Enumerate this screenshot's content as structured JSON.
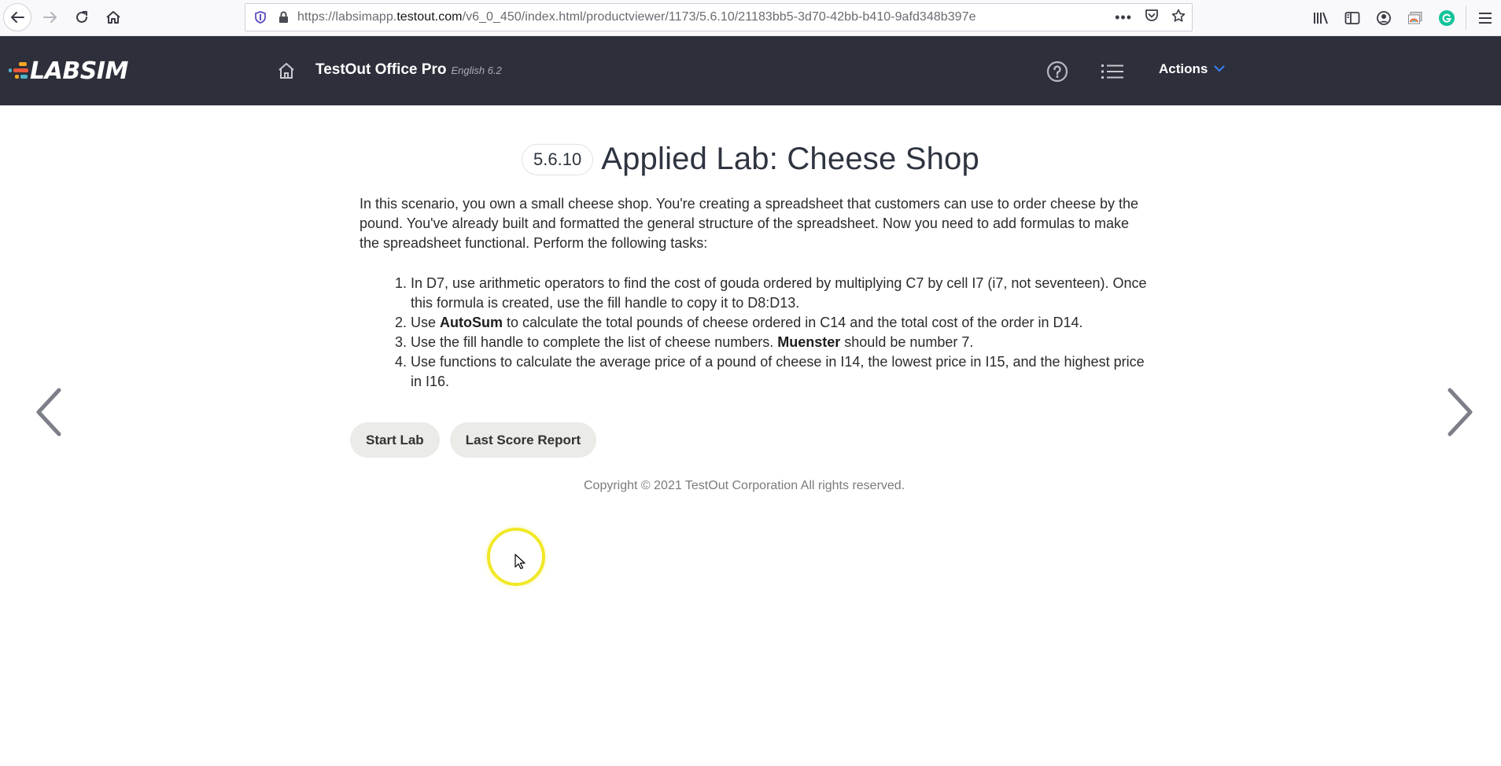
{
  "browser": {
    "url_prefix": "https://labsimapp.",
    "url_domain": "testout.com",
    "url_path": "/v6_0_450/index.html/productviewer/1173/5.6.10/21183bb5-3d70-42bb-b410-9afd348b397e",
    "icons": {
      "back": "back-arrow-icon",
      "forward": "forward-arrow-icon",
      "reload": "reload-icon",
      "home": "home-icon",
      "tracking": "shield-icon",
      "lock": "lock-icon",
      "more": "more-dots-icon",
      "pocket": "pocket-icon",
      "bookmark": "star-icon",
      "library": "library-icon",
      "sidebar": "sidebar-icon",
      "account": "account-icon",
      "extension": "extension-icon",
      "grammarly": "grammarly-icon",
      "menu": "hamburger-menu-icon"
    }
  },
  "header": {
    "logo_text": "LABSIM",
    "product_title": "TestOut Office Pro",
    "product_version": "English 6.2",
    "actions_label": "Actions",
    "colors": {
      "background": "#2d2f3a",
      "accent": "#3b82f6"
    }
  },
  "lab": {
    "number": "5.6.10",
    "title": "Applied Lab: Cheese Shop",
    "intro": "In this scenario, you own a small cheese shop. You're creating a spreadsheet that customers can use to order cheese by the pound. You've already built and formatted the general structure of the spreadsheet. Now you need to add formulas to make the spreadsheet functional. Perform the following tasks:",
    "tasks": [
      {
        "num": "1.",
        "pre": "In D7, use arithmetic operators to find the cost of gouda ordered by multiplying C7 by cell I7 (i7, not seventeen). Once this formula is created, use the fill handle to copy it to D8:D13.",
        "bold": "",
        "post": ""
      },
      {
        "num": "2.",
        "pre": "Use ",
        "bold": "AutoSum",
        "post": " to calculate the total pounds of cheese ordered in C14 and the total cost of the order in D14."
      },
      {
        "num": "3.",
        "pre": "Use the fill handle to complete the list of cheese numbers. ",
        "bold": "Muenster",
        "post": " should be number 7."
      },
      {
        "num": "4.",
        "pre": "Use functions to calculate the average price of a pound of cheese in I14, the lowest price in I15, and the highest price in I16.",
        "bold": "",
        "post": ""
      }
    ],
    "buttons": {
      "start": "Start Lab",
      "report": "Last Score Report"
    },
    "copyright": "Copyright © 2021 TestOut Corporation  All rights reserved."
  },
  "navigation": {
    "prev_icon": "chevron-left-icon",
    "next_icon": "chevron-right-icon"
  }
}
